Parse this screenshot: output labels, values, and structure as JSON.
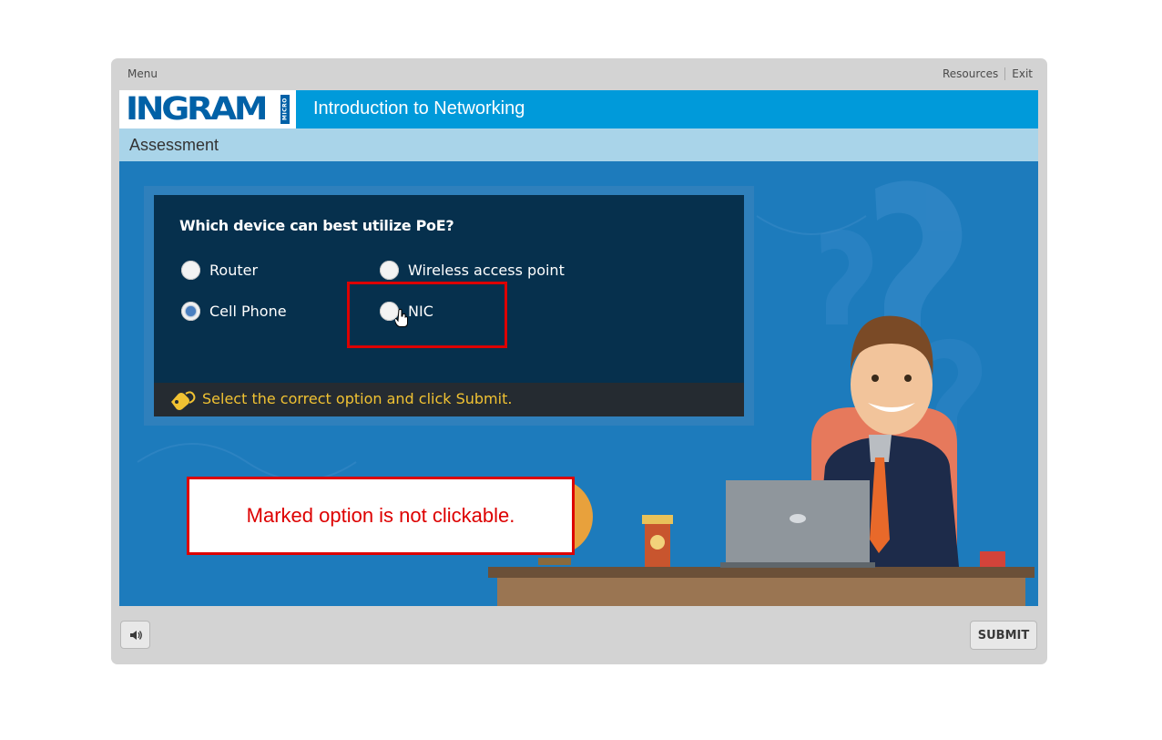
{
  "topbar": {
    "menu_label": "Menu",
    "resources_label": "Resources",
    "exit_label": "Exit"
  },
  "header": {
    "logo_text": "INGRAM",
    "logo_micro": "MICRO",
    "course_title": "Introduction to Networking"
  },
  "subheader": {
    "title": "Assessment"
  },
  "quiz": {
    "question": "Which device can best utilize PoE?",
    "options": [
      {
        "label": "Router",
        "selected": false
      },
      {
        "label": "Wireless access point",
        "selected": false
      },
      {
        "label": "Cell Phone",
        "selected": true
      },
      {
        "label": "NIC",
        "selected": false
      }
    ],
    "hint": "Select the correct option and click Submit."
  },
  "annotation": {
    "text": "Marked option is not clickable."
  },
  "footer": {
    "submit_label": "SUBMIT",
    "mute_icon": "speaker-icon"
  },
  "colors": {
    "brand_blue": "#009ada",
    "stage_blue": "#1d7bbc",
    "panel_navy": "#06304d",
    "hint_yellow": "#f1c232",
    "annotation_red": "#dd0000"
  }
}
